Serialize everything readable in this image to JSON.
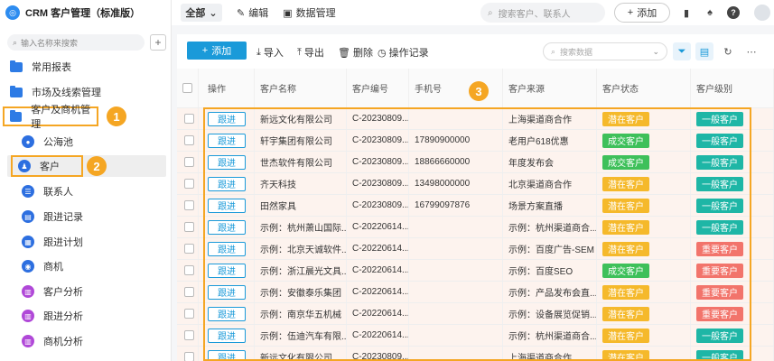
{
  "app": {
    "logo_glyph": "◎",
    "title": "CRM 客户管理（标准版）"
  },
  "sidebar": {
    "search_placeholder": "输入名称来搜索",
    "add_glyph": "+",
    "items": [
      {
        "label": "常用报表",
        "icon": "folder-icon"
      },
      {
        "label": "市场及线索管理",
        "icon": "folder-icon"
      },
      {
        "label": "客户及商机管理",
        "icon": "folder-icon"
      },
      {
        "label": "公海池",
        "icon": "pool-icon"
      },
      {
        "label": "客户",
        "icon": "customer-icon"
      },
      {
        "label": "联系人",
        "icon": "contact-icon"
      },
      {
        "label": "跟进记录",
        "icon": "record-icon"
      },
      {
        "label": "跟进计划",
        "icon": "plan-icon"
      },
      {
        "label": "商机",
        "icon": "opportunity-icon"
      },
      {
        "label": "客户分析",
        "icon": "analysis-icon"
      },
      {
        "label": "跟进分析",
        "icon": "analysis-icon"
      },
      {
        "label": "商机分析",
        "icon": "analysis-icon"
      }
    ]
  },
  "annotations": [
    "1",
    "2",
    "3"
  ],
  "topbar": {
    "view_label": "全部",
    "edit_label": "编辑",
    "datamgmt_label": "数据管理",
    "search_placeholder": "搜索客户、联系人",
    "add_label": "添加",
    "help_glyph": "?"
  },
  "toolbar": {
    "add_label": "添加",
    "import_label": "导入",
    "export_label": "导出",
    "delete_label": "删除",
    "oplog_label": "操作记录",
    "search_placeholder": "搜索数据"
  },
  "table": {
    "columns": [
      "操作",
      "客户名称",
      "客户编号",
      "手机号",
      "客户来源",
      "客户状态",
      "客户级别"
    ],
    "follow_label": "跟进",
    "rows": [
      {
        "name": "新远文化有限公司",
        "code": "C-20230809...",
        "phone": "",
        "source": "上海渠道商合作",
        "status": "潜在客户",
        "level": "一般客户"
      },
      {
        "name": "轩宇集团有限公司",
        "code": "C-20230809...",
        "phone": "17890900000",
        "source": "老用户618优惠",
        "status": "成交客户",
        "level": "一般客户"
      },
      {
        "name": "世杰软件有限公司",
        "code": "C-20230809...",
        "phone": "18866660000",
        "source": "年度发布会",
        "status": "成交客户",
        "level": "一般客户"
      },
      {
        "name": "齐天科技",
        "code": "C-20230809...",
        "phone": "13498000000",
        "source": "北京渠道商合作",
        "status": "潜在客户",
        "level": "一般客户"
      },
      {
        "name": "田然家具",
        "code": "C-20230809...",
        "phone": "16799097876",
        "source": "场景方案直播",
        "status": "潜在客户",
        "level": "一般客户"
      },
      {
        "name": "示例：杭州萧山国际...",
        "code": "C-20220614...",
        "phone": "",
        "source": "示例：杭州渠道商合...",
        "status": "潜在客户",
        "level": "一般客户"
      },
      {
        "name": "示例：北京天诚软件...",
        "code": "C-20220614...",
        "phone": "",
        "source": "示例：百度广告-SEM",
        "status": "潜在客户",
        "level": "重要客户"
      },
      {
        "name": "示例：浙江晨光文具...",
        "code": "C-20220614...",
        "phone": "",
        "source": "示例：百度SEO",
        "status": "成交客户",
        "level": "重要客户"
      },
      {
        "name": "示例：安徽泰乐集团",
        "code": "C-20220614...",
        "phone": "",
        "source": "示例：产品发布会直...",
        "status": "潜在客户",
        "level": "重要客户"
      },
      {
        "name": "示例：南京华五机械",
        "code": "C-20220614...",
        "phone": "",
        "source": "示例：设备展览促销...",
        "status": "潜在客户",
        "level": "重要客户"
      },
      {
        "name": "示例：伍迪汽车有限...",
        "code": "C-20220614...",
        "phone": "",
        "source": "示例：杭州渠道商合...",
        "status": "潜在客户",
        "level": "一般客户"
      },
      {
        "name": "新远文化有限公司",
        "code": "C-20230809...",
        "phone": "",
        "source": "上海渠道商合作",
        "status": "潜在客户",
        "level": "一般客户"
      }
    ]
  },
  "colors": {
    "status": {
      "潜在客户": "#f5b92b",
      "成交客户": "#3ec05a"
    },
    "level": {
      "一般客户": "#1eb6a6",
      "重要客户": "#f2746b"
    },
    "highlight": "#f5a623",
    "accent": "#1a9ad9"
  }
}
